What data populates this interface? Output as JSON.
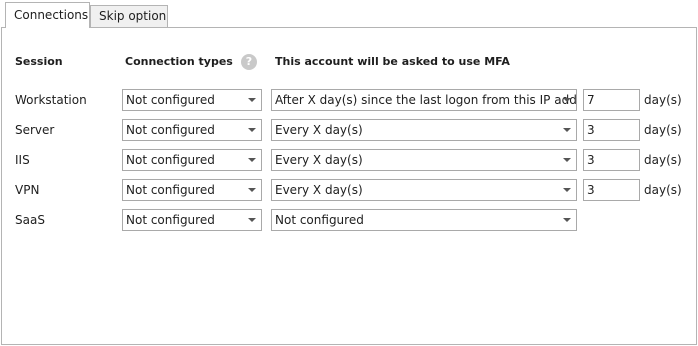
{
  "tabs": [
    {
      "label": "Connections",
      "active": true
    },
    {
      "label": "Skip option",
      "active": false
    }
  ],
  "headers": {
    "session": "Session",
    "connection_types": "Connection types",
    "help_glyph": "?",
    "mfa": "This account will be asked to use MFA"
  },
  "rows": [
    {
      "session": "Workstation",
      "connection_type": "Not configured",
      "mfa": "After X day(s) since the last logon from this IP address",
      "days": "7",
      "unit": "day(s)"
    },
    {
      "session": "Server",
      "connection_type": "Not configured",
      "mfa": "Every X day(s)",
      "days": "3",
      "unit": "day(s)"
    },
    {
      "session": "IIS",
      "connection_type": "Not configured",
      "mfa": "Every X day(s)",
      "days": "3",
      "unit": "day(s)"
    },
    {
      "session": "VPN",
      "connection_type": "Not configured",
      "mfa": "Every X day(s)",
      "days": "3",
      "unit": "day(s)"
    },
    {
      "session": "SaaS",
      "connection_type": "Not configured",
      "mfa": "Not configured"
    }
  ]
}
